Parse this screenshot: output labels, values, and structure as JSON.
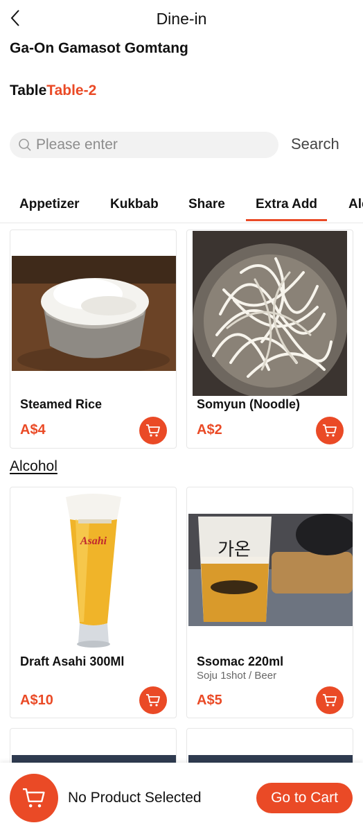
{
  "header": {
    "title": "Dine-in"
  },
  "restaurant": {
    "name": "Ga-On Gamasot Gomtang"
  },
  "table": {
    "prefix": "Table",
    "value": "Table-2"
  },
  "search": {
    "placeholder": "Please enter",
    "button_label": "Search"
  },
  "tabs": [
    {
      "label": "Appetizer",
      "active": false
    },
    {
      "label": "Kukbab",
      "active": false
    },
    {
      "label": "Share",
      "active": false
    },
    {
      "label": "Extra Add",
      "active": true
    },
    {
      "label": "Alcohol",
      "active": false
    }
  ],
  "extra_add": {
    "items": [
      {
        "name": "Steamed Rice",
        "price": "A$4",
        "image": "steamed-rice-photo"
      },
      {
        "name": "Somyun (Noodle)",
        "price": "A$2",
        "image": "noodle-photo"
      }
    ]
  },
  "alcohol": {
    "title": "Alcohol",
    "items": [
      {
        "name": "Draft Asahi 300Ml",
        "price": "A$10",
        "image": "asahi-beer-photo"
      },
      {
        "name": "Ssomac 220ml",
        "subtitle": "Soju 1shot / Beer",
        "price": "A$5",
        "image": "ssomac-photo",
        "glass_text": "가온"
      }
    ]
  },
  "bottom_bar": {
    "status": "No Product Selected",
    "button_label": "Go to Cart"
  },
  "colors": {
    "accent": "#ea4a26",
    "text": "#111111",
    "muted": "#8d8d8d"
  },
  "icons": {
    "back": "chevron-left-icon",
    "search": "search-icon",
    "cart": "shopping-cart-icon"
  }
}
